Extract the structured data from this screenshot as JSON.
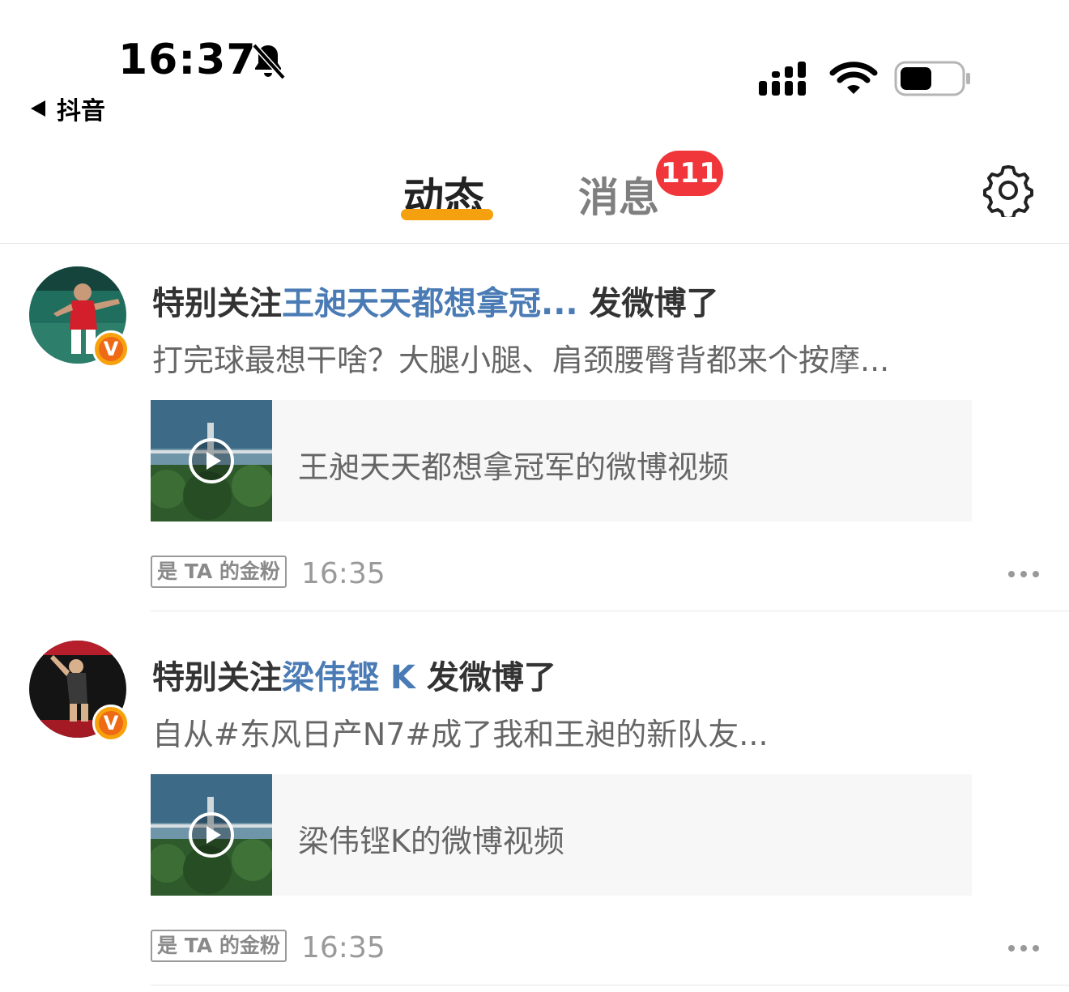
{
  "status_bar": {
    "time": "16:37",
    "back_app_label": "抖音"
  },
  "header": {
    "tabs": [
      {
        "label": "动态",
        "active": true
      },
      {
        "label": "消息",
        "active": false,
        "badge": "111"
      }
    ]
  },
  "feed": [
    {
      "title_prefix": "特别关注",
      "title_name": "王昶天天都想拿冠...",
      "title_suffix": " 发微博了",
      "body": "打完球最想干啥？大腿小腿、肩颈腰臀背都来个按摩...",
      "card_text": "王昶天天都想拿冠军的微博视频",
      "fan_tag": "是 TA 的金粉",
      "time": "16:35"
    },
    {
      "title_prefix": "特别关注",
      "title_name": "梁伟铿 K",
      "title_suffix": " 发微博了",
      "body": "自从#东风日产N7#成了我和王昶的新队友...",
      "card_text": "梁伟铿K的微博视频",
      "fan_tag": "是 TA 的金粉",
      "time": "16:35"
    }
  ],
  "colors": {
    "accent_underline": "#f5a10f",
    "badge": "#f1363b",
    "link_name": "#4a7bb5"
  },
  "icons": [
    "bell-slash-icon",
    "back-triangle-icon",
    "cellular-signal-icon",
    "wifi-icon",
    "battery-icon",
    "gear-icon",
    "play-icon",
    "verified-badge-icon",
    "more-dots-icon"
  ]
}
